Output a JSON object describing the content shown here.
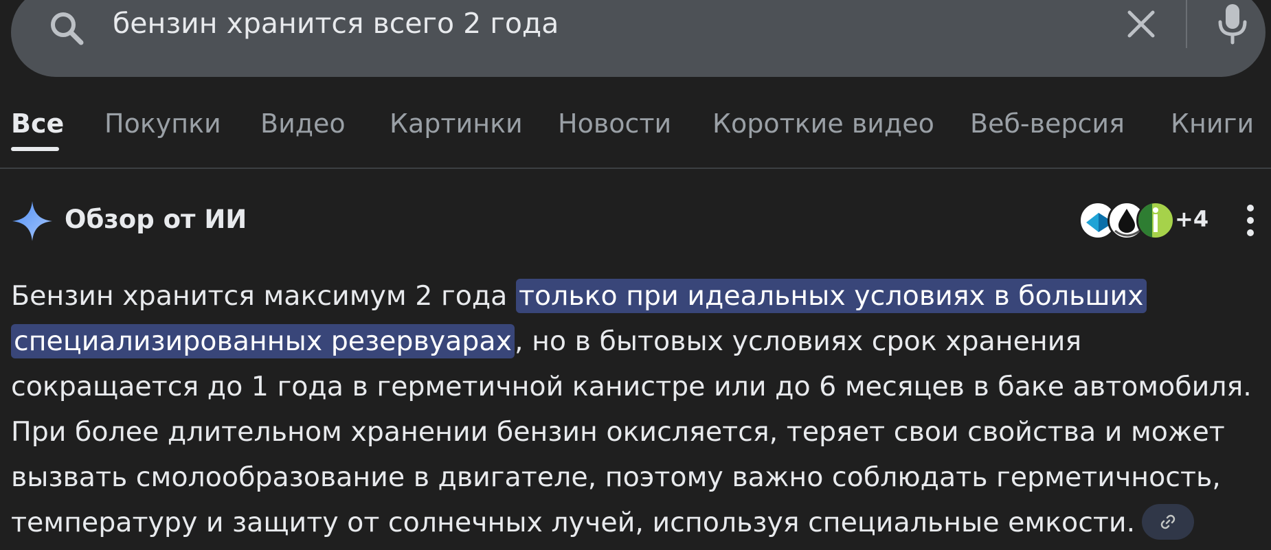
{
  "search": {
    "query": "бензин хранится всего 2 года"
  },
  "tabs": [
    {
      "label": "Все",
      "active": true
    },
    {
      "label": "Покупки",
      "active": false
    },
    {
      "label": "Видео",
      "active": false
    },
    {
      "label": "Картинки",
      "active": false
    },
    {
      "label": "Новости",
      "active": false
    },
    {
      "label": "Короткие видео",
      "active": false
    },
    {
      "label": "Веб-версия",
      "active": false
    },
    {
      "label": "Книги",
      "active": false
    }
  ],
  "ai_overview": {
    "title": "Обзор от ИИ",
    "source_count": "+4",
    "answer_before": "Бензин хранится максимум 2 года ",
    "answer_highlight": "только при идеальных условиях в больших специализированных резервуарах",
    "answer_after": ", но в бытовых условиях срок хранения сокращается до 1 года в герметичной канистре или до 6 месяцев в баке автомобиля. При более длительном хранении бензин окисляется, теряет свои свойства и может вызвать смолообразование в двигателе, поэтому важно соблюдать герметичность, температуру и защиту от солнечных лучей, используя специальные емкости."
  },
  "colors": {
    "background": "#1f1f1f",
    "search_bar": "#4d5156",
    "highlight": "#394679",
    "accent_blue": "#8ab4f8"
  }
}
